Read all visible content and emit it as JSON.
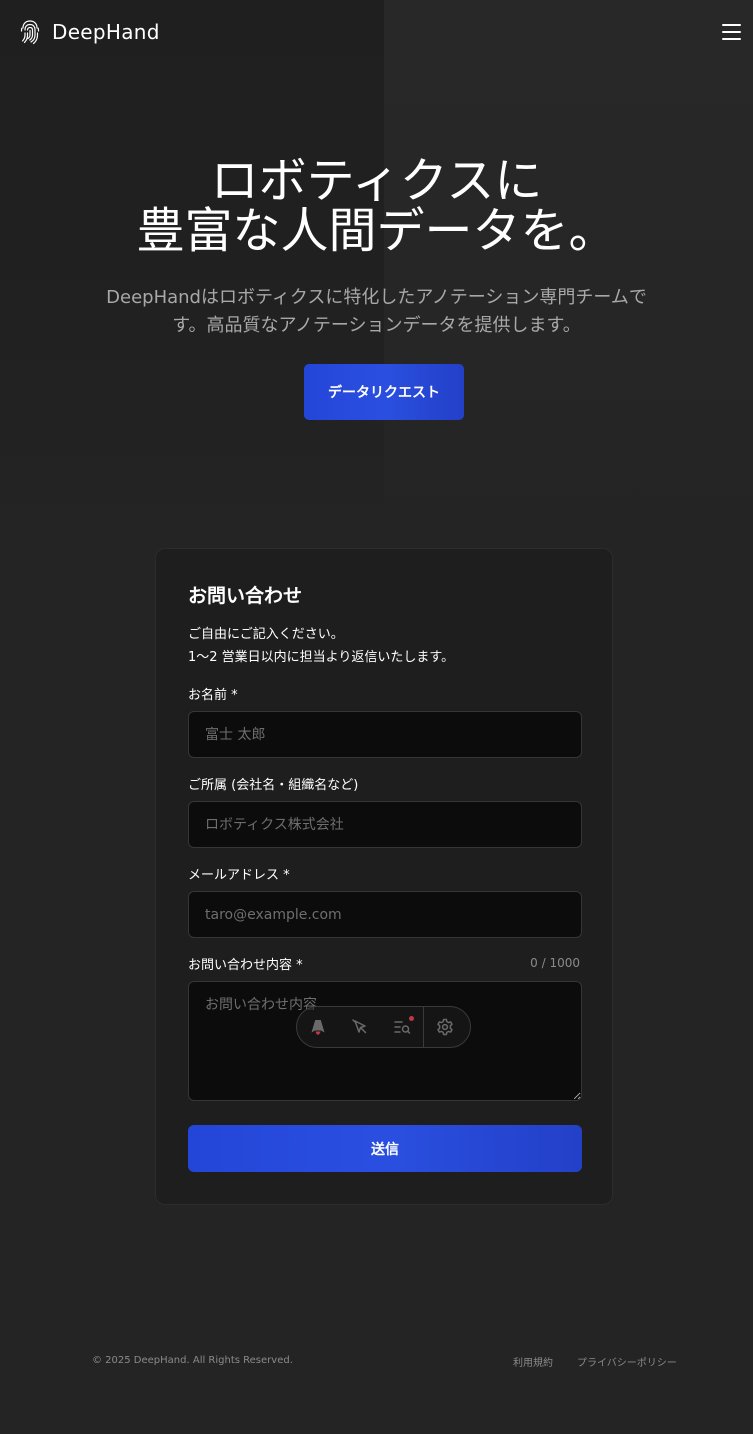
{
  "header": {
    "brand": "DeepHand",
    "logo_icon": "fingerprint-icon",
    "menu_icon": "hamburger-menu-icon"
  },
  "hero": {
    "title_line1": "ロボティクスに",
    "title_line2": "豊富な人間データを。",
    "subtitle": "DeepHandはロボティクスに特化したアノテーション専門チームです。高品質なアノテーションデータを提供します。",
    "cta_label": "データリクエスト"
  },
  "contact": {
    "title": "お問い合わせ",
    "desc_line1": "ご自由にご記入ください。",
    "desc_line2": "1〜2 営業日以内に担当より返信いたします。",
    "name_label": "お名前 *",
    "name_placeholder": "富士 太郎",
    "org_label": "ご所属 (会社名・組織名など)",
    "org_placeholder": "ロボティクス株式会社",
    "email_label": "メールアドレス *",
    "email_placeholder": "taro@example.com",
    "message_label": "お問い合わせ内容 *",
    "message_counter": "0 / 1000",
    "message_placeholder": "お問い合わせ内容",
    "submit_label": "送信"
  },
  "toolbar": {
    "items": [
      "astro-logo-icon",
      "cursor-select-icon",
      "audit-list-icon",
      "settings-gear-icon"
    ],
    "notification_color": "#c0374a"
  },
  "footer": {
    "copyright": "© 2025 DeepHand. All Rights Reserved.",
    "terms": "利用規約",
    "privacy": "プライバシーポリシー"
  },
  "colors": {
    "background": "#242424",
    "accent": "#2a4fe0",
    "card": "#1e1e1e",
    "input": "#0c0c0c"
  }
}
